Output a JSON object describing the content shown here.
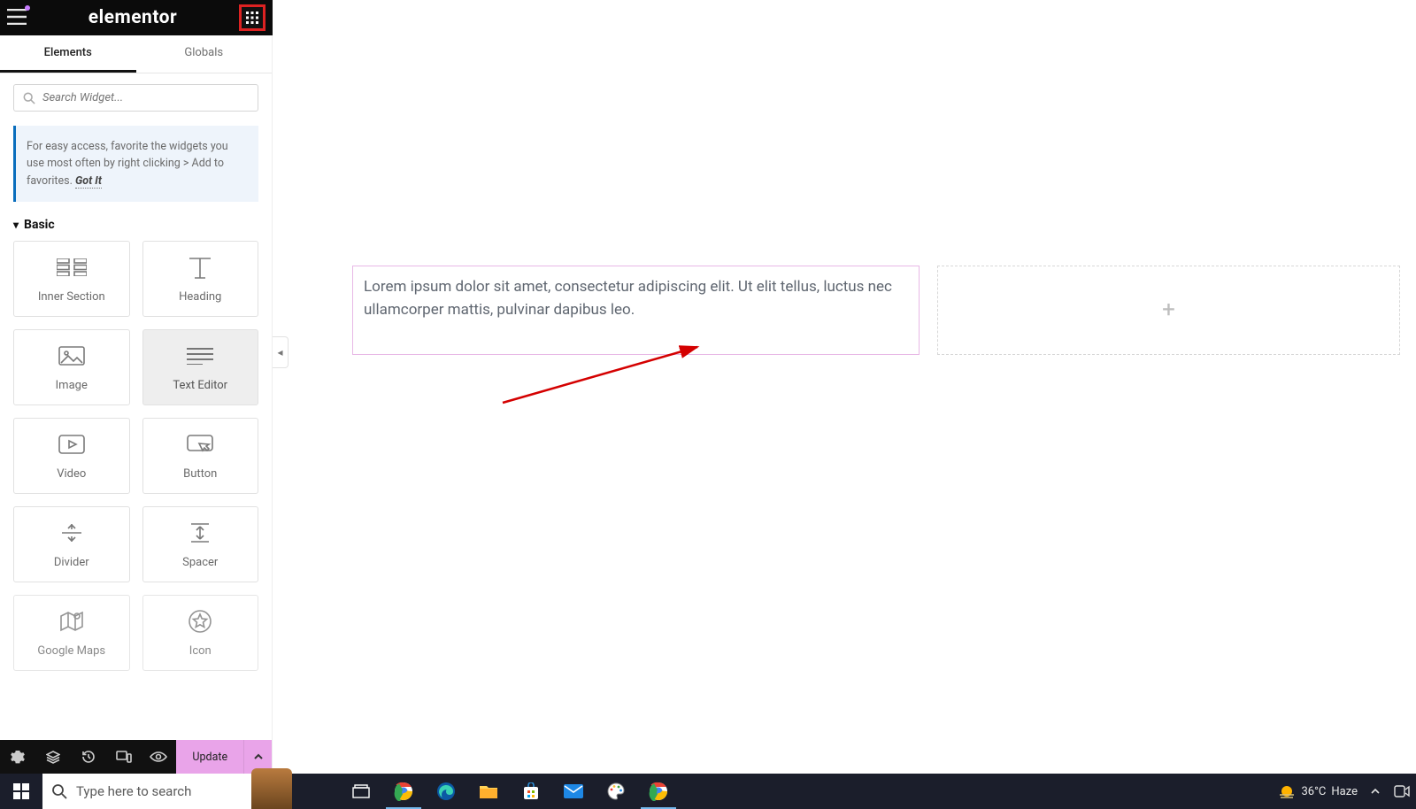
{
  "topbar": {
    "logo": "elementor"
  },
  "tabs": {
    "elements": "Elements",
    "globals": "Globals"
  },
  "search": {
    "placeholder": "Search Widget..."
  },
  "hint": {
    "text": "For easy access, favorite the widgets you use most often by right clicking > Add to favorites.",
    "gotit": "Got It"
  },
  "category": {
    "basic": "Basic"
  },
  "widgets": {
    "inner_section": "Inner Section",
    "heading": "Heading",
    "image": "Image",
    "text_editor": "Text Editor",
    "video": "Video",
    "button": "Button",
    "divider": "Divider",
    "spacer": "Spacer",
    "google_maps": "Google Maps",
    "icon": "Icon"
  },
  "footer": {
    "update": "Update"
  },
  "canvas": {
    "lorem": "Lorem ipsum dolor sit amet, consectetur adipiscing elit. Ut elit tellus, luctus nec ullamcorper mattis, pulvinar dapibus leo.",
    "plus": "+"
  },
  "taskbar": {
    "search_placeholder": "Type here to search",
    "weather_temp": "36°C",
    "weather_desc": "Haze"
  }
}
